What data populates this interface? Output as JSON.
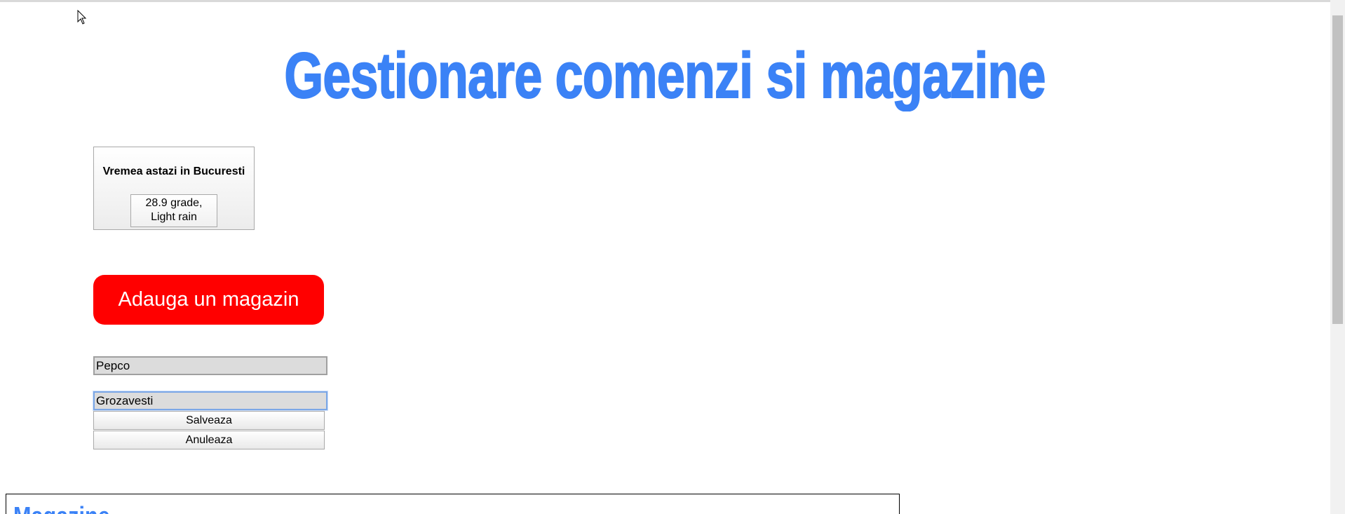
{
  "header": {
    "title": "Gestionare comenzi si magazine"
  },
  "weather": {
    "title": "Vremea astazi in Bucuresti",
    "value_line1": "28.9 grade,",
    "value_line2": "Light rain"
  },
  "actions": {
    "add_store_label": "Adauga un magazin"
  },
  "form": {
    "name_value": "Pepco",
    "location_value": "Grozavesti",
    "save_label": "Salveaza",
    "cancel_label": "Anuleaza"
  },
  "stores": {
    "heading": "Magazine"
  },
  "colors": {
    "title_blue": "#3b82f6",
    "add_button_red": "#ff0000"
  }
}
